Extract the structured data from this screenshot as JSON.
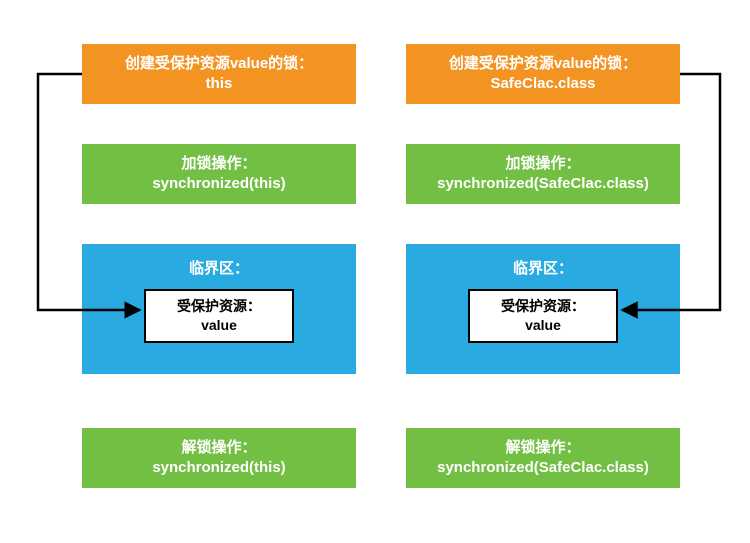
{
  "colors": {
    "orange": "#f39322",
    "green": "#72bf44",
    "blue": "#29abe2",
    "black": "#000000",
    "white": "#ffffff"
  },
  "left": {
    "create": {
      "line1": "创建受保护资源value的锁：",
      "line2": "this"
    },
    "lock": {
      "line1": "加锁操作：",
      "line2": "synchronized(this)"
    },
    "crit": {
      "title": "临界区：",
      "inner1": "受保护资源：",
      "inner2": "value"
    },
    "unlock": {
      "line1": "解锁操作：",
      "line2": "synchronized(this)"
    }
  },
  "right": {
    "create": {
      "line1": "创建受保护资源value的锁：",
      "line2": "SafeClac.class"
    },
    "lock": {
      "line1": "加锁操作：",
      "line2": "synchronized(SafeClac.class)"
    },
    "crit": {
      "title": "临界区：",
      "inner1": "受保护资源：",
      "inner2": "value"
    },
    "unlock": {
      "line1": "解锁操作：",
      "line2": "synchronized(SafeClac.class)"
    }
  }
}
